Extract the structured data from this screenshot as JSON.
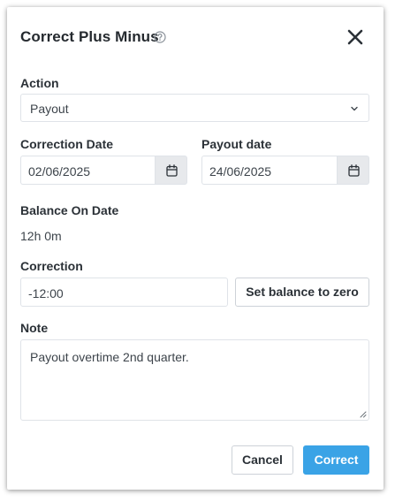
{
  "dialog": {
    "title": "Correct Plus Minus",
    "icons": {
      "help": "question-circle-icon",
      "close": "close-x-icon",
      "chevron": "chevron-down-icon",
      "calendar": "calendar-icon"
    }
  },
  "form": {
    "action": {
      "label": "Action",
      "value": "Payout"
    },
    "correction_date": {
      "label": "Correction Date",
      "value": "02/06/2025"
    },
    "payout_date": {
      "label": "Payout date",
      "value": "24/06/2025"
    },
    "balance": {
      "label": "Balance On Date",
      "value": "12h 0m"
    },
    "correction": {
      "label": "Correction",
      "value": "-12:00",
      "zero_button": "Set balance to zero"
    },
    "note": {
      "label": "Note",
      "value": "Payout overtime 2nd quarter."
    }
  },
  "footer": {
    "cancel": "Cancel",
    "submit": "Correct"
  },
  "colors": {
    "primary": "#3aa3e6",
    "text": "#2b3137",
    "border": "#dfe3e8",
    "addon_bg": "#e7e9ec"
  }
}
